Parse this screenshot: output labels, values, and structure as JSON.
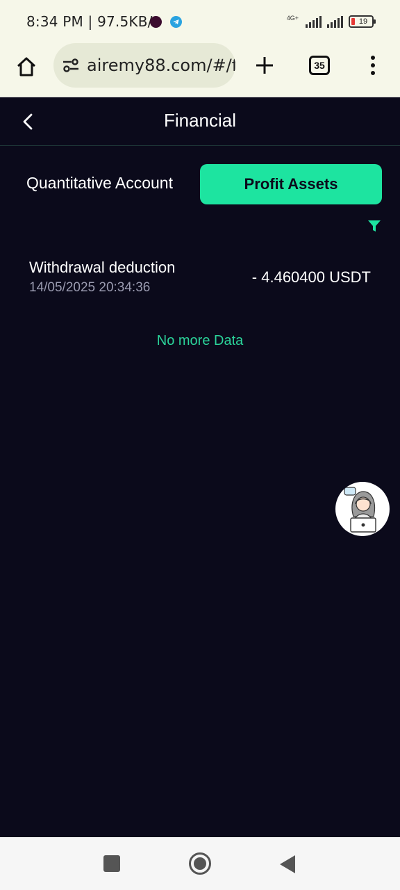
{
  "status_bar": {
    "time": "8:34 PM",
    "speed": "97.5KB/s",
    "network": "4G+",
    "battery": "19"
  },
  "browser": {
    "url": "airemy88.com/#/f",
    "tab_count": "35"
  },
  "header": {
    "title": "Financial"
  },
  "tabs": [
    {
      "label": "Quantitative Account",
      "active": false
    },
    {
      "label": "Profit Assets",
      "active": true
    }
  ],
  "records": [
    {
      "title": "Withdrawal deduction",
      "time": "14/05/2025 20:34:36",
      "amount": "- 4.460400 USDT"
    }
  ],
  "footer_text": "No more Data",
  "colors": {
    "background": "#0b0a1b",
    "accent": "#1de4a0",
    "muted_text": "#9a9bb0",
    "chrome": "#f6f7e9"
  },
  "icons": {
    "home": "home-icon",
    "site_settings": "site-settings-icon",
    "new_tab": "plus-icon",
    "menu": "more-vert-icon",
    "back": "chevron-left-icon",
    "filter": "filter-icon",
    "support": "customer-support-avatar-icon"
  }
}
